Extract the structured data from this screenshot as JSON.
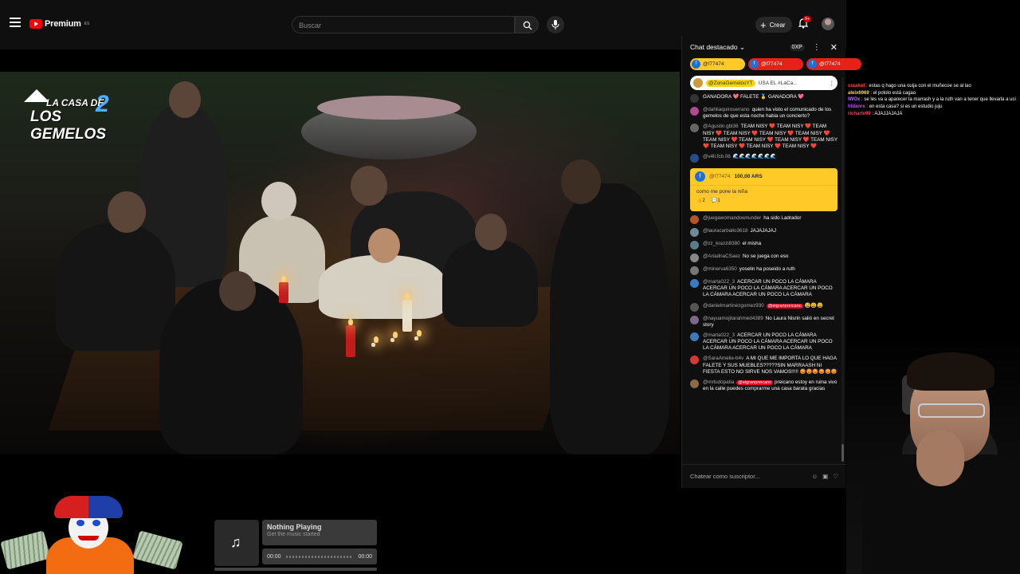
{
  "header": {
    "logo_text": "Premium",
    "logo_sup": "ES",
    "search_placeholder": "Buscar",
    "create_label": "Crear",
    "notification_count": "9+"
  },
  "video": {
    "show_logo_line1": "LA CASA DE",
    "show_logo_line2": "LOS GEMELOS",
    "show_logo_number": "2"
  },
  "chat": {
    "title": "Chat destacado",
    "xp": "0XP",
    "tickers": [
      {
        "name": "@f77474",
        "color": "#ffca28",
        "text_color": "#222"
      },
      {
        "name": "@f77474",
        "color": "#e62117",
        "text_color": "#fff"
      },
      {
        "name": "@f77474",
        "color": "#e62117",
        "text_color": "#fff"
      }
    ],
    "pinned": {
      "author": "@ZonaGemelosYT",
      "text": "USA EL #LaCa..."
    },
    "messages": [
      {
        "author": "",
        "text": "GANADORA 💖 FALETE 🥇 GANADORA 💖",
        "avatar": "#333"
      },
      {
        "author": "@dahliaquiroserrano",
        "text": "quien ha visto el comunicado de los gemelos de que esta noche habia un concierto?",
        "avatar": "#b04a8e"
      },
      {
        "author": "@Agustin.gbl36",
        "text": "TEAM NISY ❤️ TEAM NISY ❤️ TEAM NISY ❤️ TEAM NISY ❤️ TEAM NISY ❤️ TEAM NISY ❤️ TEAM NISY ❤️ TEAM NISY ❤️ TEAM NISY ❤️ TEAM NISY ❤️ TEAM NISY ❤️ TEAM NISY ❤️ TEAM NISY ❤️",
        "avatar": "#666"
      },
      {
        "author": "@v4ll.fcb.06",
        "text": "🌊🌊🌊🌊🌊🌊🌊",
        "avatar": "#2a4a8a"
      }
    ],
    "superchat": {
      "author": "@f77474",
      "amount": "100,00 ARS",
      "text": "como me pone la niña",
      "likes": "2",
      "replies": "1"
    },
    "messages2": [
      {
        "author": "@juegawomandownunder",
        "text": "ha sido Ladrador",
        "avatar": "#b4542a"
      },
      {
        "author": "@lauracarballo3618",
        "text": "JAJAJAJAJ",
        "avatar": "#6b8a9a"
      },
      {
        "author": "@zz_krazzi8380",
        "text": "el misha",
        "avatar": "#5c7b8a"
      },
      {
        "author": "@AriadnaCSaez",
        "text": "No se juega con eso",
        "avatar": "#888"
      },
      {
        "author": "@minerva6350",
        "text": "yoselin ha poseido a ruth",
        "avatar": "#777"
      },
      {
        "author": "@marta022_3",
        "text": "ACERCAR UN POCO LA CÁMARA ACERCAR UN POCO LA CÁMARA ACERCAR UN POCO LA CÁMARA ACERCAR UN POCO LA CÁMARA",
        "avatar": "#3a7ac0"
      },
      {
        "author": "@danielmartinezgomez930",
        "badge": "@elgranpreicano",
        "text": "😩😩😩",
        "avatar": "#555"
      },
      {
        "author": "@nayuamojitarahmed4389",
        "text": "No Laura Nisrin salió en secret story",
        "avatar": "#7a6a8a"
      },
      {
        "author": "@marta022_3",
        "text": "ACERCAR UN POCO LA CÁMARA ACERCAR UN POCO LA CÁMARA ACERCAR UN POCO LA CÁMARA ACERCAR UN POCO LA CÁMARA",
        "avatar": "#3a7ac0"
      },
      {
        "author": "@SaraAmelie-b4v",
        "text": "A MI QUE ME IMPORTA LO QUE HAGA FALETE Y SUS MUEBLES?????SIN MARRAASH NI FIESTA ESTO NO SIRVE NOS VAMOS!!!!! 😡😡😡😡😡😡",
        "avatar": "#d23a3a"
      },
      {
        "author": "@mrludopatia",
        "badge": "@elgranpreicano",
        "text": "preicano estoy en ruina vivo en la calle puedes comprarme una casa barata gracias",
        "avatar": "#8a6a4a"
      }
    ],
    "input_placeholder": "Chatear como suscriptor..."
  },
  "external_chat": [
    {
      "user": "craakof",
      "color": "#ff4040",
      "text": "estas q hago una ouija con el muñecoe se al lao"
    },
    {
      "user": "aleix6969",
      "color": "#ffd84a",
      "text": "el pololo está cagao"
    },
    {
      "user": "IWOx",
      "color": "#b072ff",
      "text": "se les va a aparecer la marrash y a la ruth van a tener que llevarla a uci"
    },
    {
      "user": "hidanrx",
      "color": "#c64dff",
      "text": "en esta casa? si es un estudio juju"
    },
    {
      "user": "richarte99",
      "color": "#ff3a6a",
      "text": "AJAJJAJAJA"
    }
  ],
  "music_player": {
    "title": "Nothing Playing",
    "subtitle": "Get the music started",
    "time_start": "00:00",
    "time_end": "00:00",
    "progress": 0
  }
}
